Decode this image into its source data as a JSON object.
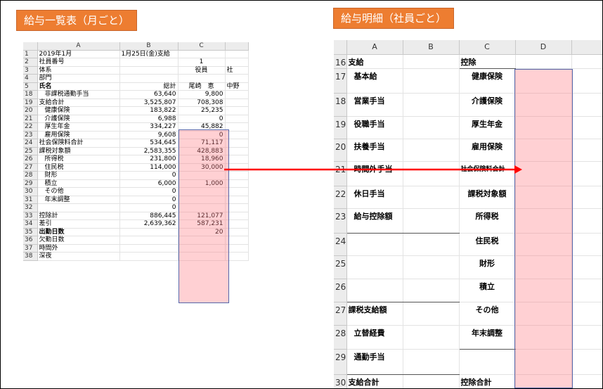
{
  "titles": {
    "left": "給与一覧表（月ごと）",
    "right": "給与明細（社員ごと）"
  },
  "colors": {
    "title_bg": "#ED7D31",
    "highlight": "#FF7882",
    "arrow": "#FF0000"
  },
  "left_sheet": {
    "col_headers": [
      "",
      "A",
      "B",
      "C",
      ""
    ],
    "rows": [
      {
        "n": "1",
        "a": "2019年1月",
        "b": "1月25日(金)支給",
        "c": "",
        "d": ""
      },
      {
        "n": "2",
        "a": "社員番号",
        "b": "",
        "c": "1",
        "d": ""
      },
      {
        "n": "3",
        "a": "体系",
        "b": "",
        "c": "役員",
        "d": "社"
      },
      {
        "n": "4",
        "a": "部門",
        "b": "",
        "c": "",
        "d": ""
      },
      {
        "n": "5",
        "a": "氏名",
        "b": "総計",
        "c": "尾崎　恵",
        "d": "中野"
      },
      {
        "n": "18",
        "a": "非課税通勤手当",
        "b": "63,640",
        "c": "9,800",
        "d": ""
      },
      {
        "n": "19",
        "a": "支給合計",
        "b": "3,525,807",
        "c": "708,308",
        "d": ""
      },
      {
        "n": "20",
        "a": "健康保険",
        "b": "183,822",
        "c": "25,235",
        "d": ""
      },
      {
        "n": "21",
        "a": "介護保険",
        "b": "6,988",
        "c": "0",
        "d": ""
      },
      {
        "n": "22",
        "a": "厚生年金",
        "b": "334,227",
        "c": "45,882",
        "d": ""
      },
      {
        "n": "23",
        "a": "雇用保険",
        "b": "9,608",
        "c": "0",
        "d": ""
      },
      {
        "n": "24",
        "a": "社会保険料合計",
        "b": "534,645",
        "c": "71,117",
        "d": ""
      },
      {
        "n": "25",
        "a": "課税対象額",
        "b": "2,583,355",
        "c": "428,883",
        "d": ""
      },
      {
        "n": "26",
        "a": "所得税",
        "b": "231,800",
        "c": "18,960",
        "d": ""
      },
      {
        "n": "27",
        "a": "住民税",
        "b": "114,000",
        "c": "30,000",
        "d": ""
      },
      {
        "n": "28",
        "a": "財形",
        "b": "0",
        "c": "",
        "d": ""
      },
      {
        "n": "29",
        "a": "積立",
        "b": "6,000",
        "c": "1,000",
        "d": ""
      },
      {
        "n": "30",
        "a": "その他",
        "b": "0",
        "c": "",
        "d": ""
      },
      {
        "n": "31",
        "a": "年末調整",
        "b": "0",
        "c": "",
        "d": ""
      },
      {
        "n": "32",
        "a": "",
        "b": "0",
        "c": "",
        "d": ""
      },
      {
        "n": "33",
        "a": "控除計",
        "b": "886,445",
        "c": "121,077",
        "d": ""
      },
      {
        "n": "34",
        "a": "差引",
        "b": "2,639,362",
        "c": "587,231",
        "d": ""
      },
      {
        "n": "35",
        "a": "出勤日数",
        "b": "",
        "c": "20",
        "d": ""
      },
      {
        "n": "36",
        "a": "欠勤日数",
        "b": "",
        "c": "",
        "d": ""
      },
      {
        "n": "37",
        "a": "時間外",
        "b": "",
        "c": "",
        "d": ""
      },
      {
        "n": "38",
        "a": "深夜",
        "b": "",
        "c": "",
        "d": ""
      }
    ]
  },
  "right_sheet": {
    "col_headers": [
      "",
      "A",
      "B",
      "C",
      "D"
    ],
    "rows": [
      {
        "n": "16",
        "a": "支給",
        "c": "控除"
      },
      {
        "n": "17",
        "a": "基本給",
        "c": "健康保険"
      },
      {
        "n": "18",
        "a": "営業手当",
        "c": "介護保険"
      },
      {
        "n": "19",
        "a": "役職手当",
        "c": "厚生年金"
      },
      {
        "n": "20",
        "a": "扶養手当",
        "c": "雇用保険"
      },
      {
        "n": "21",
        "a": "時間外手当",
        "c": "社会保険料合計"
      },
      {
        "n": "22",
        "a": "休日手当",
        "c": "課税対象額"
      },
      {
        "n": "23",
        "a": "給与控除額",
        "c": "所得税"
      },
      {
        "n": "24",
        "a": "",
        "c": "住民税"
      },
      {
        "n": "25",
        "a": "",
        "c": "財形"
      },
      {
        "n": "26",
        "a": "",
        "c": "積立"
      },
      {
        "n": "27",
        "a": "課税支給額",
        "c": "その他"
      },
      {
        "n": "28",
        "a": "立替経費",
        "c": "年末調整"
      },
      {
        "n": "29",
        "a": "通勤手当",
        "c": ""
      },
      {
        "n": "30",
        "a": "支給合計",
        "c": "控除合計"
      }
    ]
  }
}
